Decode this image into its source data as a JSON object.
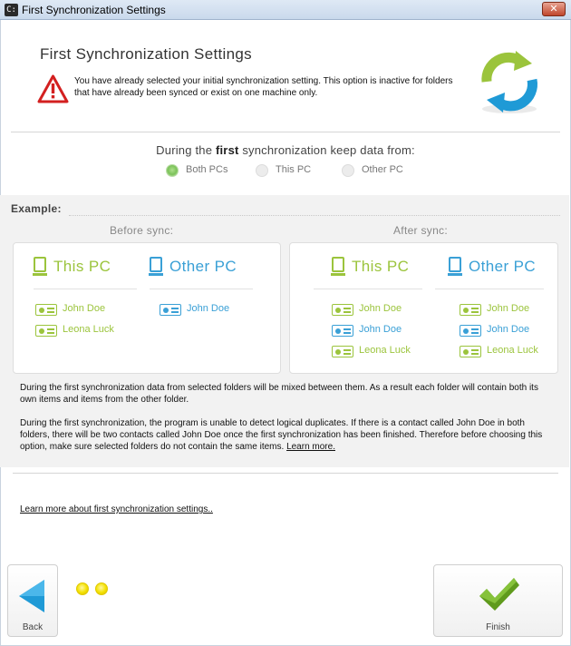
{
  "window": {
    "title": "First Synchronization Settings",
    "close_label": "✕",
    "app_icon_text": "C:"
  },
  "header": {
    "title": "First Synchronization Settings",
    "warning": "You have already selected your initial synchronization setting. This option is inactive for folders that have already been synced or exist on one machine only."
  },
  "keep": {
    "prefix": "During the ",
    "bold": "first",
    "suffix": " synchronization keep data from:",
    "options": [
      {
        "label": "Both PCs",
        "selected": true
      },
      {
        "label": "This PC",
        "selected": false
      },
      {
        "label": "Other PC",
        "selected": false
      }
    ]
  },
  "example": {
    "label": "Example:",
    "before": {
      "label": "Before sync:",
      "this_pc": {
        "title": "This PC",
        "contacts": [
          "John Doe",
          "Leona Luck"
        ]
      },
      "other_pc": {
        "title": "Other PC",
        "contacts": [
          "John Doe"
        ]
      }
    },
    "after": {
      "label": "After sync:",
      "this_pc": {
        "title": "This PC",
        "contacts": [
          "John Doe",
          "John Doe",
          "Leona Luck"
        ]
      },
      "other_pc": {
        "title": "Other PC",
        "contacts": [
          "John Doe",
          "John Doe",
          "Leona Luck"
        ]
      }
    }
  },
  "description": {
    "para1": "During the first synchronization data from selected folders will be mixed between them. As a result each folder will contain both its own items and items from the other folder.",
    "para2": "During the first synchronization, the program is unable to detect logical duplicates. If there is a contact called John Doe in both folders, there will be two contacts called John Doe once the first synchronization has been finished. Therefore before choosing this option, make sure selected folders do not contain the same items. ",
    "learn_more": "Learn more."
  },
  "footer": {
    "learn_more_link": "Learn more about first synchronization settings..",
    "back_label": "Back",
    "finish_label": "Finish"
  },
  "colors": {
    "green": "#9bc43c",
    "blue": "#3aa0d6",
    "arrow_blue": "#1f9ad6",
    "check_green": "#5f9a1c"
  }
}
